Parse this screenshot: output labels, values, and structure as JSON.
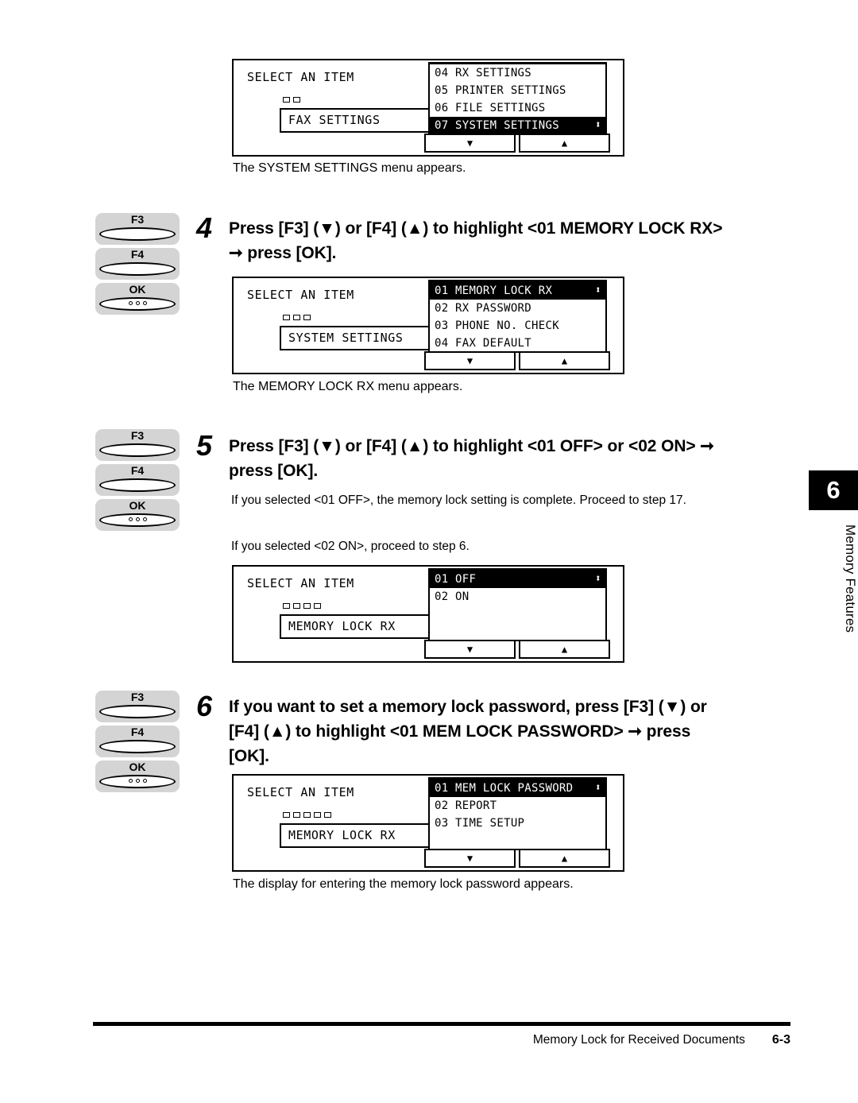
{
  "chapter_tab": {
    "number": "6",
    "label": "Memory Features"
  },
  "panel_top": {
    "title": "SELECT AN ITEM",
    "crumb_label": "FAX SETTINGS",
    "crumb_depth": 2,
    "items": [
      {
        "index": "04",
        "label": "RX SETTINGS",
        "selected": false
      },
      {
        "index": "05",
        "label": "PRINTER SETTINGS",
        "selected": false
      },
      {
        "index": "06",
        "label": "FILE SETTINGS",
        "selected": false
      },
      {
        "index": "07",
        "label": "SYSTEM SETTINGS",
        "selected": true
      }
    ],
    "softkey_down": "▼",
    "softkey_up": "▲",
    "updown_glyph": "⬍",
    "caption": "The SYSTEM SETTINGS menu appears."
  },
  "step4": {
    "number": "4",
    "heading_line1": "Press [F3] (▼) or [F4] (▲) to highlight <01 MEMORY LOCK RX>",
    "heading_line2": "➞ press [OK].",
    "keys": [
      {
        "label": "F3",
        "type": "lens"
      },
      {
        "label": "F4",
        "type": "lens"
      },
      {
        "label": "OK",
        "type": "lens-dots"
      }
    ],
    "panel": {
      "title": "SELECT AN ITEM",
      "crumb_label": "SYSTEM SETTINGS",
      "crumb_depth": 3,
      "items": [
        {
          "index": "01",
          "label": "MEMORY LOCK RX",
          "selected": true
        },
        {
          "index": "02",
          "label": "RX PASSWORD",
          "selected": false
        },
        {
          "index": "03",
          "label": "PHONE NO. CHECK",
          "selected": false
        },
        {
          "index": "04",
          "label": "FAX DEFAULT",
          "selected": false
        }
      ],
      "softkey_down": "▼",
      "softkey_up": "▲",
      "updown_glyph": "⬍"
    },
    "caption": "The MEMORY LOCK RX menu appears."
  },
  "step5": {
    "number": "5",
    "heading_line1": "Press [F3] (▼) or [F4] (▲) to highlight <01 OFF> or <02 ON> ➞",
    "heading_line2": "press [OK].",
    "keys": [
      {
        "label": "F3",
        "type": "lens"
      },
      {
        "label": "F4",
        "type": "lens"
      },
      {
        "label": "OK",
        "type": "lens-dots"
      }
    ],
    "body_para1": "If you selected <01 OFF>, the memory lock setting is complete. Proceed to step 17.",
    "body_para2": "If you selected <02 ON>, proceed to step 6.",
    "panel": {
      "title": "SELECT AN ITEM",
      "crumb_label": "MEMORY LOCK RX",
      "crumb_depth": 4,
      "items": [
        {
          "index": "01",
          "label": "OFF",
          "selected": true
        },
        {
          "index": "02",
          "label": "ON",
          "selected": false
        }
      ],
      "softkey_down": "▼",
      "softkey_up": "▲",
      "updown_glyph": "⬍"
    }
  },
  "step6": {
    "number": "6",
    "heading_line1": "If you want to set a memory lock password, press [F3] (▼) or",
    "heading_line2": "[F4] (▲) to highlight <01 MEM LOCK PASSWORD> ➞ press",
    "heading_line3": "[OK].",
    "keys": [
      {
        "label": "F3",
        "type": "lens"
      },
      {
        "label": "F4",
        "type": "lens"
      },
      {
        "label": "OK",
        "type": "lens-dots"
      }
    ],
    "panel": {
      "title": "SELECT AN ITEM",
      "crumb_label": "MEMORY LOCK RX",
      "crumb_depth": 5,
      "items": [
        {
          "index": "01",
          "label": "MEM LOCK PASSWORD",
          "selected": true
        },
        {
          "index": "02",
          "label": "REPORT",
          "selected": false
        },
        {
          "index": "03",
          "label": "TIME SETUP",
          "selected": false
        }
      ],
      "softkey_down": "▼",
      "softkey_up": "▲",
      "updown_glyph": "⬍"
    },
    "caption": "The display for entering the memory lock password appears."
  },
  "footer": {
    "section_title": "Memory Lock for Received Documents",
    "page_number": "6-3"
  }
}
